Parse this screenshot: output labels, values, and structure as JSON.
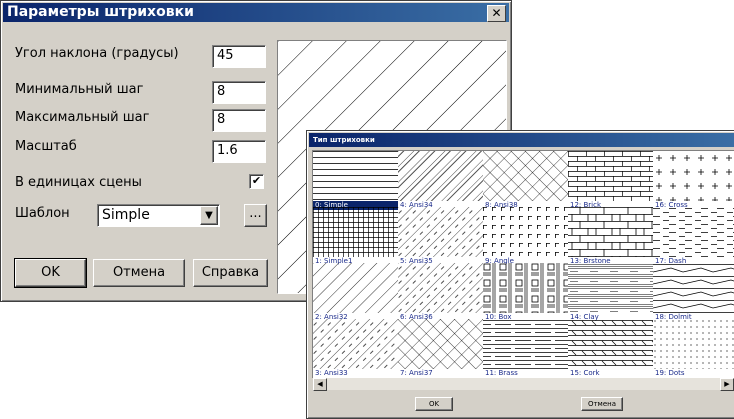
{
  "main_dialog": {
    "title": "Параметры штриховки",
    "close_glyph": "✕",
    "angle_label": "Угол наклона (градусы)",
    "angle_value": "45",
    "min_step_label": "Минимальный шаг",
    "min_step_value": "8",
    "max_step_label": "Максимальный шаг",
    "max_step_value": "8",
    "scale_label": "Масштаб",
    "scale_value": "1.6",
    "scene_units_label": "В единицах сцены",
    "scene_units_checked": "✔",
    "template_label": "Шаблон",
    "template_value": "Simple",
    "browse_label": "...",
    "ok_label": "OK",
    "cancel_label": "Отмена",
    "help_label": "Справка"
  },
  "hatch_dialog": {
    "title": "Тип штриховки",
    "ok_label": "OK",
    "cancel_label": "Отмена",
    "selected": "0: Simple",
    "patterns": [
      [
        "0: Simple",
        "4: Ansi34",
        "8: Ansi38",
        "12: Brick",
        "16: Cross"
      ],
      [
        "1: Simple1",
        "5: Ansi35",
        "9: Angle",
        "13: Brstone",
        "17: Dash"
      ],
      [
        "2: Ansi32",
        "6: Ansi36",
        "10: Box",
        "14: Clay",
        "18: Dolmit"
      ],
      [
        "3: Ansi33",
        "7: Ansi37",
        "11: Brass",
        "15: Cork",
        "19: Dots"
      ]
    ]
  }
}
